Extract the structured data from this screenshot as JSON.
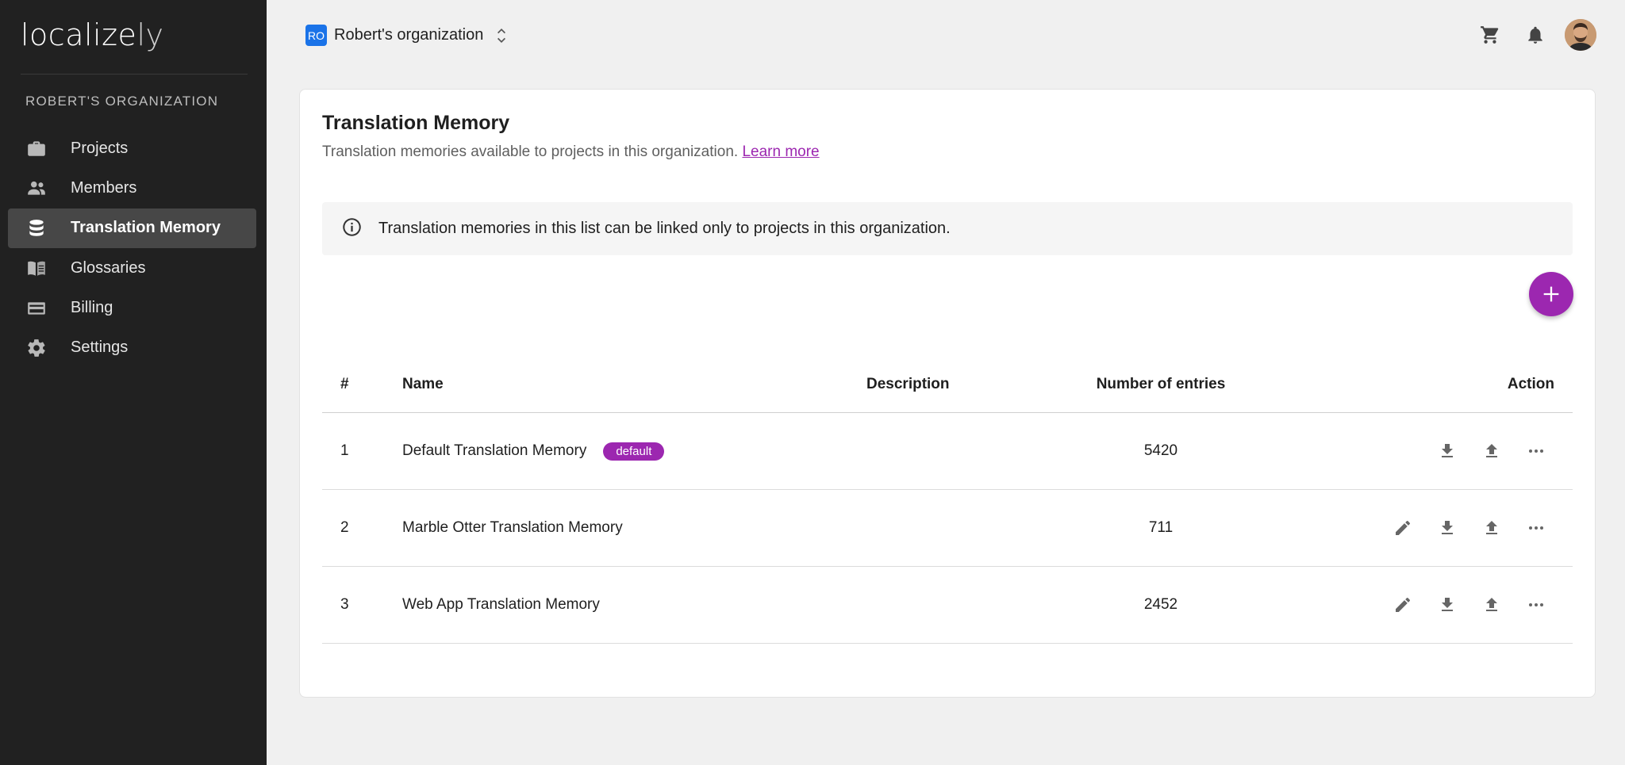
{
  "app": {
    "logo_main": "localize",
    "logo_suffix": "ly"
  },
  "sidebar": {
    "org_heading": "ROBERT'S ORGANIZATION",
    "items": [
      {
        "label": "Projects",
        "icon": "briefcase-icon",
        "active": false
      },
      {
        "label": "Members",
        "icon": "people-icon",
        "active": false
      },
      {
        "label": "Translation Memory",
        "icon": "database-icon",
        "active": true
      },
      {
        "label": "Glossaries",
        "icon": "book-icon",
        "active": false
      },
      {
        "label": "Billing",
        "icon": "credit-card-icon",
        "active": false
      },
      {
        "label": "Settings",
        "icon": "gear-icon",
        "active": false
      }
    ]
  },
  "topbar": {
    "org_initials": "RO",
    "org_name": "Robert's organization",
    "icons": [
      "cart-icon",
      "bell-icon",
      "avatar"
    ]
  },
  "page": {
    "title": "Translation Memory",
    "subtitle": "Translation memories available to projects in this organization.",
    "learn_more": "Learn more",
    "info": "Translation memories in this list can be linked only to projects in this organization."
  },
  "table": {
    "headers": {
      "num": "#",
      "name": "Name",
      "description": "Description",
      "entries": "Number of entries",
      "action": "Action"
    },
    "rows": [
      {
        "num": "1",
        "name": "Default Translation Memory",
        "badge": "default",
        "description": "",
        "entries": "5420",
        "editable": false
      },
      {
        "num": "2",
        "name": "Marble Otter Translation Memory",
        "badge": "",
        "description": "",
        "entries": "711",
        "editable": true
      },
      {
        "num": "3",
        "name": "Web App Translation Memory",
        "badge": "",
        "description": "",
        "entries": "2452",
        "editable": true
      }
    ]
  },
  "colors": {
    "accent": "#9c27b0",
    "sidebar_bg": "#212121",
    "org_badge": "#1a73e8"
  }
}
